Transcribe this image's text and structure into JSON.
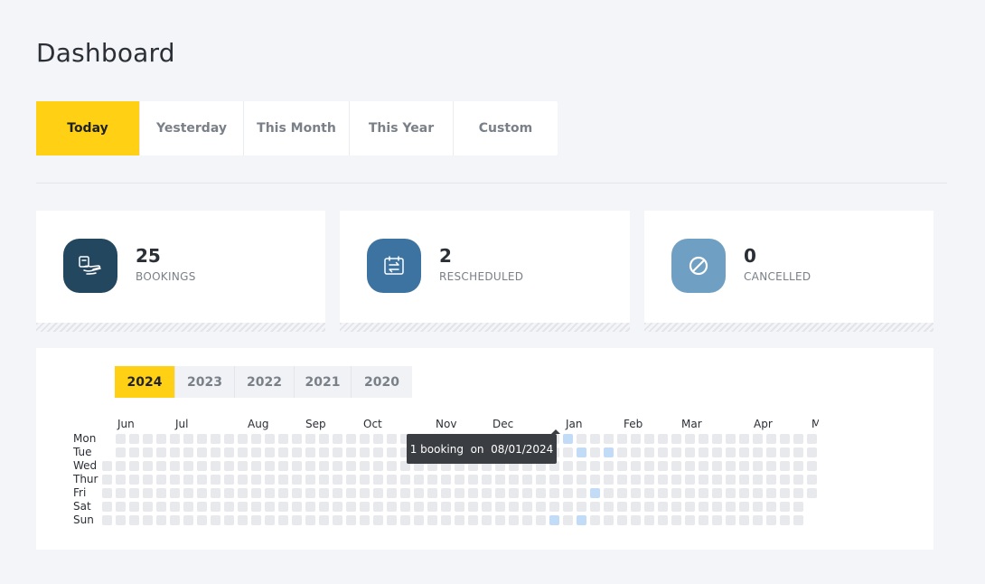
{
  "page": {
    "title": "Dashboard"
  },
  "filters": [
    {
      "label": "Today",
      "active": true
    },
    {
      "label": "Yesterday",
      "active": false
    },
    {
      "label": "This Month",
      "active": false
    },
    {
      "label": "This Year",
      "active": false
    },
    {
      "label": "Custom",
      "active": false
    }
  ],
  "stats": [
    {
      "value": "25",
      "label": "BOOKINGS",
      "icon": "hand-booking-icon",
      "color": "#23475f"
    },
    {
      "value": "2",
      "label": "RESCHEDULED",
      "icon": "calendar-swap-icon",
      "color": "#3d73a0"
    },
    {
      "value": "0",
      "label": "CANCELLED",
      "icon": "cancel-circle-icon",
      "color": "#6f9fc3"
    }
  ],
  "years": [
    {
      "label": "2024",
      "active": true
    },
    {
      "label": "2023",
      "active": false
    },
    {
      "label": "2022",
      "active": false
    },
    {
      "label": "2021",
      "active": false
    },
    {
      "label": "2020",
      "active": false
    }
  ],
  "heatmap": {
    "months": [
      "Jun",
      "Jul",
      "Aug",
      "Sep",
      "Oct",
      "Nov",
      "Dec",
      "Jan",
      "Feb",
      "Mar",
      "Apr",
      "May"
    ],
    "days": [
      "Mon",
      "Tue",
      "Wed",
      "Thur",
      "Fri",
      "Sat",
      "Sun"
    ],
    "week_count": 53,
    "active_cells": [
      {
        "week": 34,
        "day": 0
      },
      {
        "week": 35,
        "day": 1
      },
      {
        "week": 37,
        "day": 1
      },
      {
        "week": 36,
        "day": 4
      },
      {
        "week": 33,
        "day": 6
      },
      {
        "week": 35,
        "day": 6
      }
    ],
    "tooltip": "1 booking  on  08/01/2024"
  },
  "colors": {
    "accent": "#ffd014",
    "cell_empty": "#e8e9ec",
    "cell_active": "#c2dcf7"
  }
}
